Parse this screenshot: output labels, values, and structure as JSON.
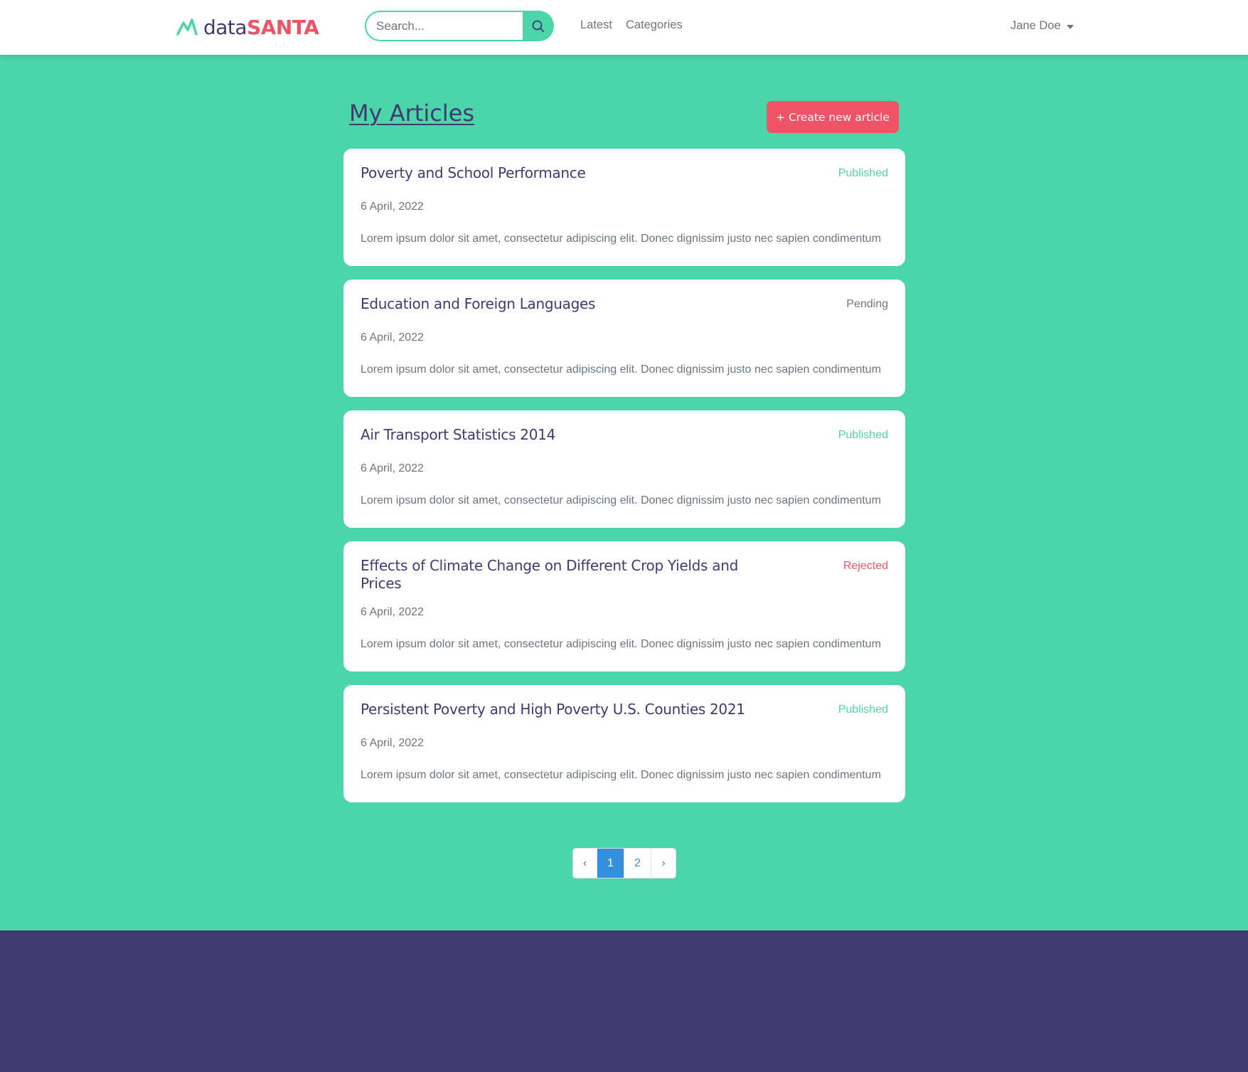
{
  "brand": {
    "prefix": "data",
    "highlight": "SANTA"
  },
  "search": {
    "placeholder": "Search..."
  },
  "nav": {
    "links": [
      "Latest",
      "Categories"
    ]
  },
  "user": {
    "name": "Jane Doe"
  },
  "page": {
    "title": "My Articles",
    "create_button": "+ Create new article"
  },
  "articles": [
    {
      "title": "Poverty and School Performance",
      "status": "Published",
      "status_color": "#4bd6aa",
      "date": "6 April, 2022",
      "excerpt": "Lorem ipsum dolor sit amet, consectetur adipiscing elit. Donec dignissim justo nec sapien condimentum"
    },
    {
      "title": "Education and Foreign Languages",
      "status": "Pending",
      "status_color": "#6c757d",
      "date": "6 April, 2022",
      "excerpt": "Lorem ipsum dolor sit amet, consectetur adipiscing elit. Donec dignissim justo nec sapien condimentum"
    },
    {
      "title": "Air Transport Statistics 2014",
      "status": "Published",
      "status_color": "#4bd6aa",
      "date": "6 April, 2022",
      "excerpt": "Lorem ipsum dolor sit amet, consectetur adipiscing elit. Donec dignissim justo nec sapien condimentum"
    },
    {
      "title": "Effects of Climate Change on Different Crop Yields and Prices",
      "status": "Rejected",
      "status_color": "#ee5466",
      "date": "6 April, 2022",
      "excerpt": "Lorem ipsum dolor sit amet, consectetur adipiscing elit. Donec dignissim justo nec sapien condimentum"
    },
    {
      "title": "Persistent Poverty and High Poverty U.S. Counties 2021",
      "status": "Published",
      "status_color": "#4bd6aa",
      "date": "6 April, 2022",
      "excerpt": "Lorem ipsum dolor sit amet, consectetur adipiscing elit. Donec dignissim justo nec sapien condimentum"
    }
  ],
  "pagination": {
    "prev": "‹",
    "pages": [
      "1",
      "2"
    ],
    "current": "1",
    "next": "›"
  },
  "colors": {
    "accent": "#4bd6aa",
    "brand_dark": "#3f3a72",
    "danger": "#ee5466",
    "link": "#3490dc",
    "footer": "#403a73"
  },
  "icons": {
    "logo": "chart-peak-icon",
    "search": "search-icon",
    "user_menu": "caret-down-icon"
  }
}
